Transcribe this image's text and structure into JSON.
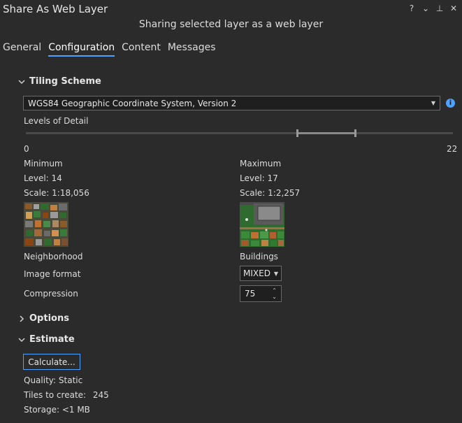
{
  "window": {
    "title": "Share As Web Layer",
    "controls": {
      "help": "?",
      "menu": "⌄",
      "pin": "⊥",
      "close": "✕"
    }
  },
  "subtitle": "Sharing selected layer as a web layer",
  "tabs": [
    {
      "label": "General"
    },
    {
      "label": "Configuration",
      "active": true
    },
    {
      "label": "Content"
    },
    {
      "label": "Messages"
    }
  ],
  "tiling": {
    "header": "Tiling Scheme",
    "scheme_value": "WGS84 Geographic Coordinate System, Version 2",
    "levels_label": "Levels of Detail",
    "range_min_label": "0",
    "range_max_label": "22",
    "selected_min": 14,
    "selected_max": 17,
    "minimum": {
      "title": "Minimum",
      "level_label": "Level:",
      "level_value": "14",
      "scale_label": "Scale:",
      "scale_value": "1:18,056",
      "thumb_caption": "Neighborhood"
    },
    "maximum": {
      "title": "Maximum",
      "level_label": "Level:",
      "level_value": "17",
      "scale_label": "Scale:",
      "scale_value": "1:2,257",
      "thumb_caption": "Buildings"
    },
    "image_format_label": "Image format",
    "image_format_value": "MIXED",
    "compression_label": "Compression",
    "compression_value": "75"
  },
  "options": {
    "header": "Options"
  },
  "estimate": {
    "header": "Estimate",
    "calculate_label": "Calculate...",
    "quality_label": "Quality:",
    "quality_value": "Static",
    "tiles_label": "Tiles to create:",
    "tiles_value": "245",
    "storage_label": "Storage:",
    "storage_value": "<1 MB"
  },
  "colors": {
    "accent": "#4da3ff",
    "background": "#2b2b2b"
  }
}
